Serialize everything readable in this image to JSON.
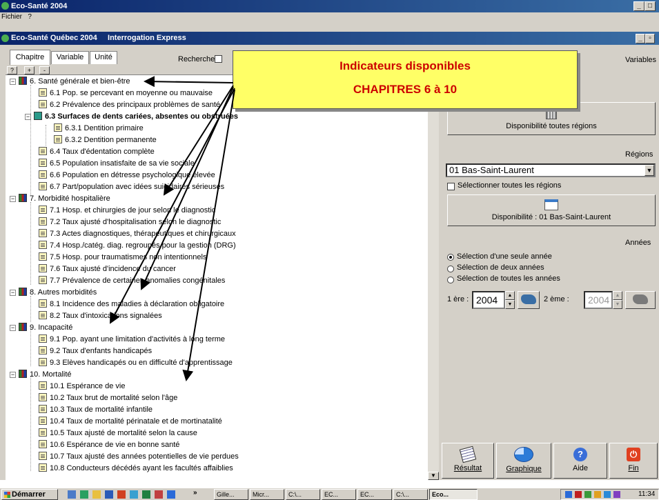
{
  "app": {
    "title": "Eco-Santé 2004",
    "menu": [
      "Fichier",
      "?"
    ]
  },
  "window": {
    "title": "Eco-Santé Québec 2004",
    "subtitle": "Interrogation Express"
  },
  "tabs": [
    "Chapitre",
    "Variable",
    "Unité"
  ],
  "search_label": "Rechercher",
  "tree_buttons": [
    "?",
    "+",
    "-"
  ],
  "callout": {
    "line1": "Indicateurs disponibles",
    "line2": "CHAPITRES 6 à 10"
  },
  "tree": [
    {
      "label": "6. Santé générale et bien-être",
      "level": 0,
      "type": "chapter"
    },
    {
      "label": "6.1 Pop. se percevant en moyenne ou mauvaise",
      "level": 1,
      "type": "doc"
    },
    {
      "label": "6.2 Prévalence des principaux problèmes de santé",
      "level": 1,
      "type": "doc"
    },
    {
      "label": "6.3 Surfaces de dents cariées, absentes ou obstruées",
      "level": 1,
      "type": "group",
      "bold": true
    },
    {
      "label": "6.3.1 Dentition primaire",
      "level": 2,
      "type": "doc"
    },
    {
      "label": "6.3.2 Dentition permanente",
      "level": 2,
      "type": "doc"
    },
    {
      "label": "6.4 Taux d'édentation complète",
      "level": 1,
      "type": "doc"
    },
    {
      "label": "6.5 Population insatisfaite de sa vie sociale",
      "level": 1,
      "type": "doc"
    },
    {
      "label": "6.6 Population en détresse psychologique élevée",
      "level": 1,
      "type": "doc"
    },
    {
      "label": "6.7 Part/population avec idées suicidaires sérieuses",
      "level": 1,
      "type": "doc"
    },
    {
      "label": "7. Morbidité hospitalière",
      "level": 0,
      "type": "chapter"
    },
    {
      "label": "7.1 Hosp. et chirurgies de jour selon le diagnostic",
      "level": 1,
      "type": "doc"
    },
    {
      "label": "7.2 Taux ajusté d'hospitalisation selon le diagnostic",
      "level": 1,
      "type": "doc"
    },
    {
      "label": "7.3 Actes diagnostiques, thérapeutiques et chirurgicaux",
      "level": 1,
      "type": "doc"
    },
    {
      "label": "7.4 Hosp./catég. diag. regroupés pour la gestion (DRG)",
      "level": 1,
      "type": "doc"
    },
    {
      "label": "7.5 Hosp. pour traumatismes non intentionnels",
      "level": 1,
      "type": "doc"
    },
    {
      "label": "7.6 Taux ajusté d'incidence du cancer",
      "level": 1,
      "type": "doc"
    },
    {
      "label": "7.7 Prévalence de certaines anomalies congénitales",
      "level": 1,
      "type": "doc"
    },
    {
      "label": "8. Autres morbidités",
      "level": 0,
      "type": "chapter"
    },
    {
      "label": "8.1 Incidence des maladies à déclaration obligatoire",
      "level": 1,
      "type": "doc"
    },
    {
      "label": "8.2 Taux d'intoxications signalées",
      "level": 1,
      "type": "doc"
    },
    {
      "label": "9. Incapacité",
      "level": 0,
      "type": "chapter"
    },
    {
      "label": "9.1 Pop. ayant une limitation d'activités à long terme",
      "level": 1,
      "type": "doc"
    },
    {
      "label": "9.2 Taux d'enfants handicapés",
      "level": 1,
      "type": "doc"
    },
    {
      "label": "9.3 Elèves handicapés ou en difficulté d'apprentissage",
      "level": 1,
      "type": "doc"
    },
    {
      "label": "10. Mortalité",
      "level": 0,
      "type": "chapter"
    },
    {
      "label": "10.1 Espérance de vie",
      "level": 1,
      "type": "doc"
    },
    {
      "label": "10.2 Taux brut de mortalité selon l'âge",
      "level": 1,
      "type": "doc"
    },
    {
      "label": "10.3 Taux de mortalité infantile",
      "level": 1,
      "type": "doc"
    },
    {
      "label": "10.4 Taux de mortalité périnatale et de mortinatalité",
      "level": 1,
      "type": "doc"
    },
    {
      "label": "10.5 Taux ajusté de mortalité selon la cause",
      "level": 1,
      "type": "doc"
    },
    {
      "label": "10.6 Espérance de vie en bonne santé",
      "level": 1,
      "type": "doc"
    },
    {
      "label": "10.7 Taux ajusté des années potentielles de vie perdues",
      "level": 1,
      "type": "doc"
    },
    {
      "label": "10.8 Conducteurs décédés ayant les facultés affaiblies",
      "level": 1,
      "type": "doc"
    }
  ],
  "right": {
    "variables_label": "Variables",
    "dispo_all_label": "Disponibilité toutes régions",
    "regions_label": "Régions",
    "region_selected": "01 Bas-Saint-Laurent",
    "select_all_regions": "Sélectionner toutes les régions",
    "dispo_region_label": "Disponibilité : 01 Bas-Saint-Laurent",
    "annees_label": "Années",
    "year_options": [
      "Sélection d'une seule année",
      "Sélection de deux années",
      "Sélection de toutes les années"
    ],
    "first_label": "1 ère :",
    "first_value": "2004",
    "second_label": "2 ème :",
    "second_value": "2004"
  },
  "actions": [
    {
      "label": "Résultat",
      "icon": "calculator-icon"
    },
    {
      "label": "Graphique",
      "icon": "pie-chart-icon"
    },
    {
      "label": "Aide",
      "icon": "help-icon"
    },
    {
      "label": "Fin",
      "icon": "power-icon"
    }
  ],
  "taskbar": {
    "start": "Démarrer",
    "items": [
      "Gille...",
      "Micr...",
      "C:\\...",
      "EC...",
      "EC...",
      "C:\\...",
      "Eco..."
    ],
    "clock": "11:34"
  },
  "colors": {
    "titlebar": "#0a246a",
    "panel": "#d4d0c8",
    "callout_bg": "#ffff66",
    "callout_text": "#cc0000"
  }
}
